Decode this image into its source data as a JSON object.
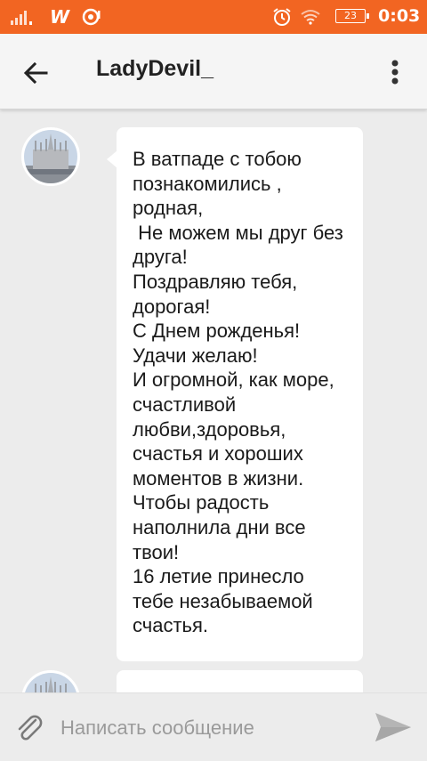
{
  "status_bar": {
    "carrier_icon": "w-logo",
    "battery_level": "23",
    "time": "0:03"
  },
  "header": {
    "title": "LadyDevil_",
    "back_icon": "arrow-left-icon",
    "menu_icon": "more-vert-icon"
  },
  "messages": [
    {
      "sender_avatar": "cathedral-avatar",
      "text": "В ватпаде с тобою познакомились , родная,\n Не можем мы друг без друга!\nПоздравляю тебя, дорогая!\nС Днем рожденья!\nУдачи желаю!\nИ огромной, как море, счастливой любви,здоровья, счастья и хороших моментов в жизни.\nЧтобы радость наполнила дни все твои!\n16 летие принесло тебе незабываемой счастья."
    },
    {
      "sender_avatar": "cathedral-avatar",
      "text": ""
    }
  ],
  "composer": {
    "placeholder": "Написать сообщение",
    "attach_icon": "paperclip-icon",
    "send_icon": "send-icon"
  },
  "colors": {
    "accent": "#f26522",
    "background": "#ececec",
    "bubble": "#ffffff"
  }
}
